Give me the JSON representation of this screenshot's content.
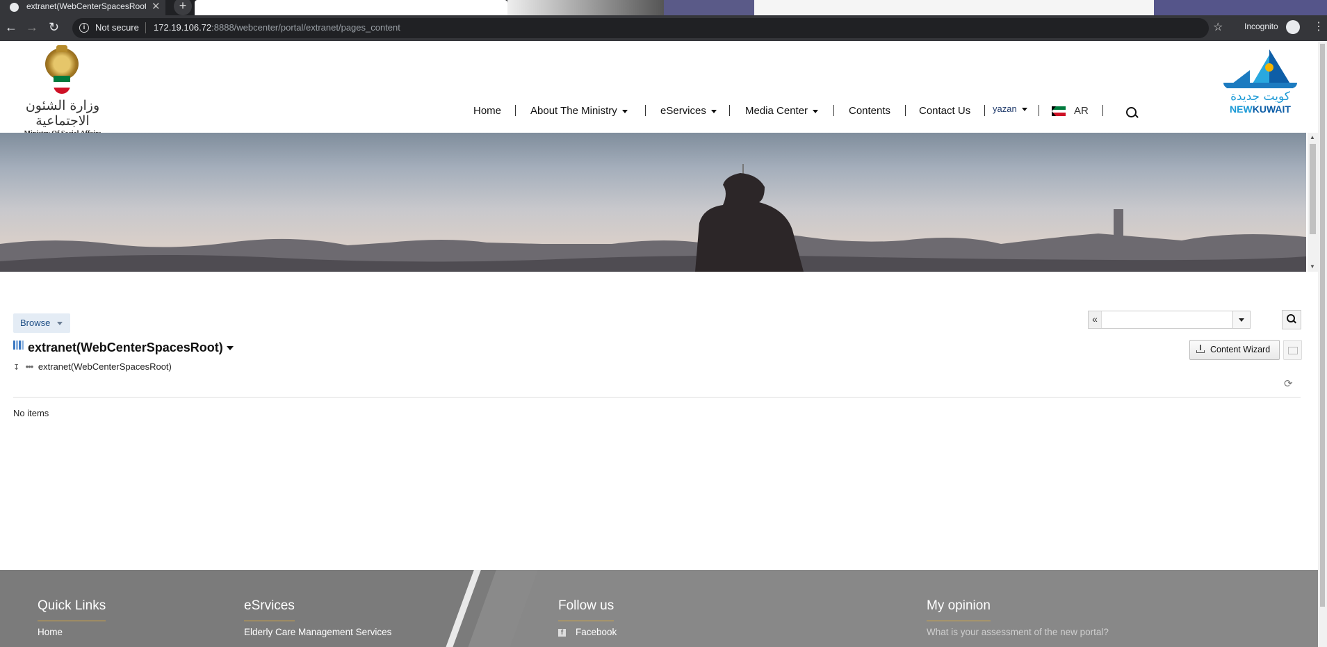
{
  "browser": {
    "tab_title": "extranet(WebCenterSpacesRoot)",
    "security": "Not secure",
    "url_host": "172.19.106.72",
    "url_rest": ":8888/webcenter/portal/extranet/pages_content",
    "incognito_label": "Incognito"
  },
  "header": {
    "ministry_logo_ar": "وزارة الشئون الاجتماعية",
    "ministry_logo_en": "Ministry Of Social Affairs",
    "nav": {
      "home": "Home",
      "about": "About The Ministry",
      "eservices": "eServices",
      "media": "Media Center",
      "contents": "Contents",
      "contact": "Contact Us",
      "user": "yazan",
      "lang": "AR"
    },
    "newkuwait_ar": "كويت جديدة",
    "newkuwait_en_1": "NEW",
    "newkuwait_en_2": "KUWAIT"
  },
  "content": {
    "browse_label": "Browse",
    "title": "extranet(WebCenterSpacesRoot)",
    "path": "extranet(WebCenterSpacesRoot)",
    "wizard_label": "Content Wizard",
    "empty_text": "No items",
    "search_value": ""
  },
  "footer": {
    "quick_links_title": "Quick Links",
    "quick_links_item": "Home",
    "eservices_title": "eSrvices",
    "eservices_item": "Elderly Care Management Services",
    "follow_title": "Follow us",
    "follow_item": "Facebook",
    "opinion_title": "My opinion",
    "opinion_question": "What is your assessment of the new portal?"
  },
  "colors": {
    "accent_blue": "#1c9ad6",
    "footer_gray": "#7b7b7b",
    "footer_underline": "#d9a93c"
  }
}
